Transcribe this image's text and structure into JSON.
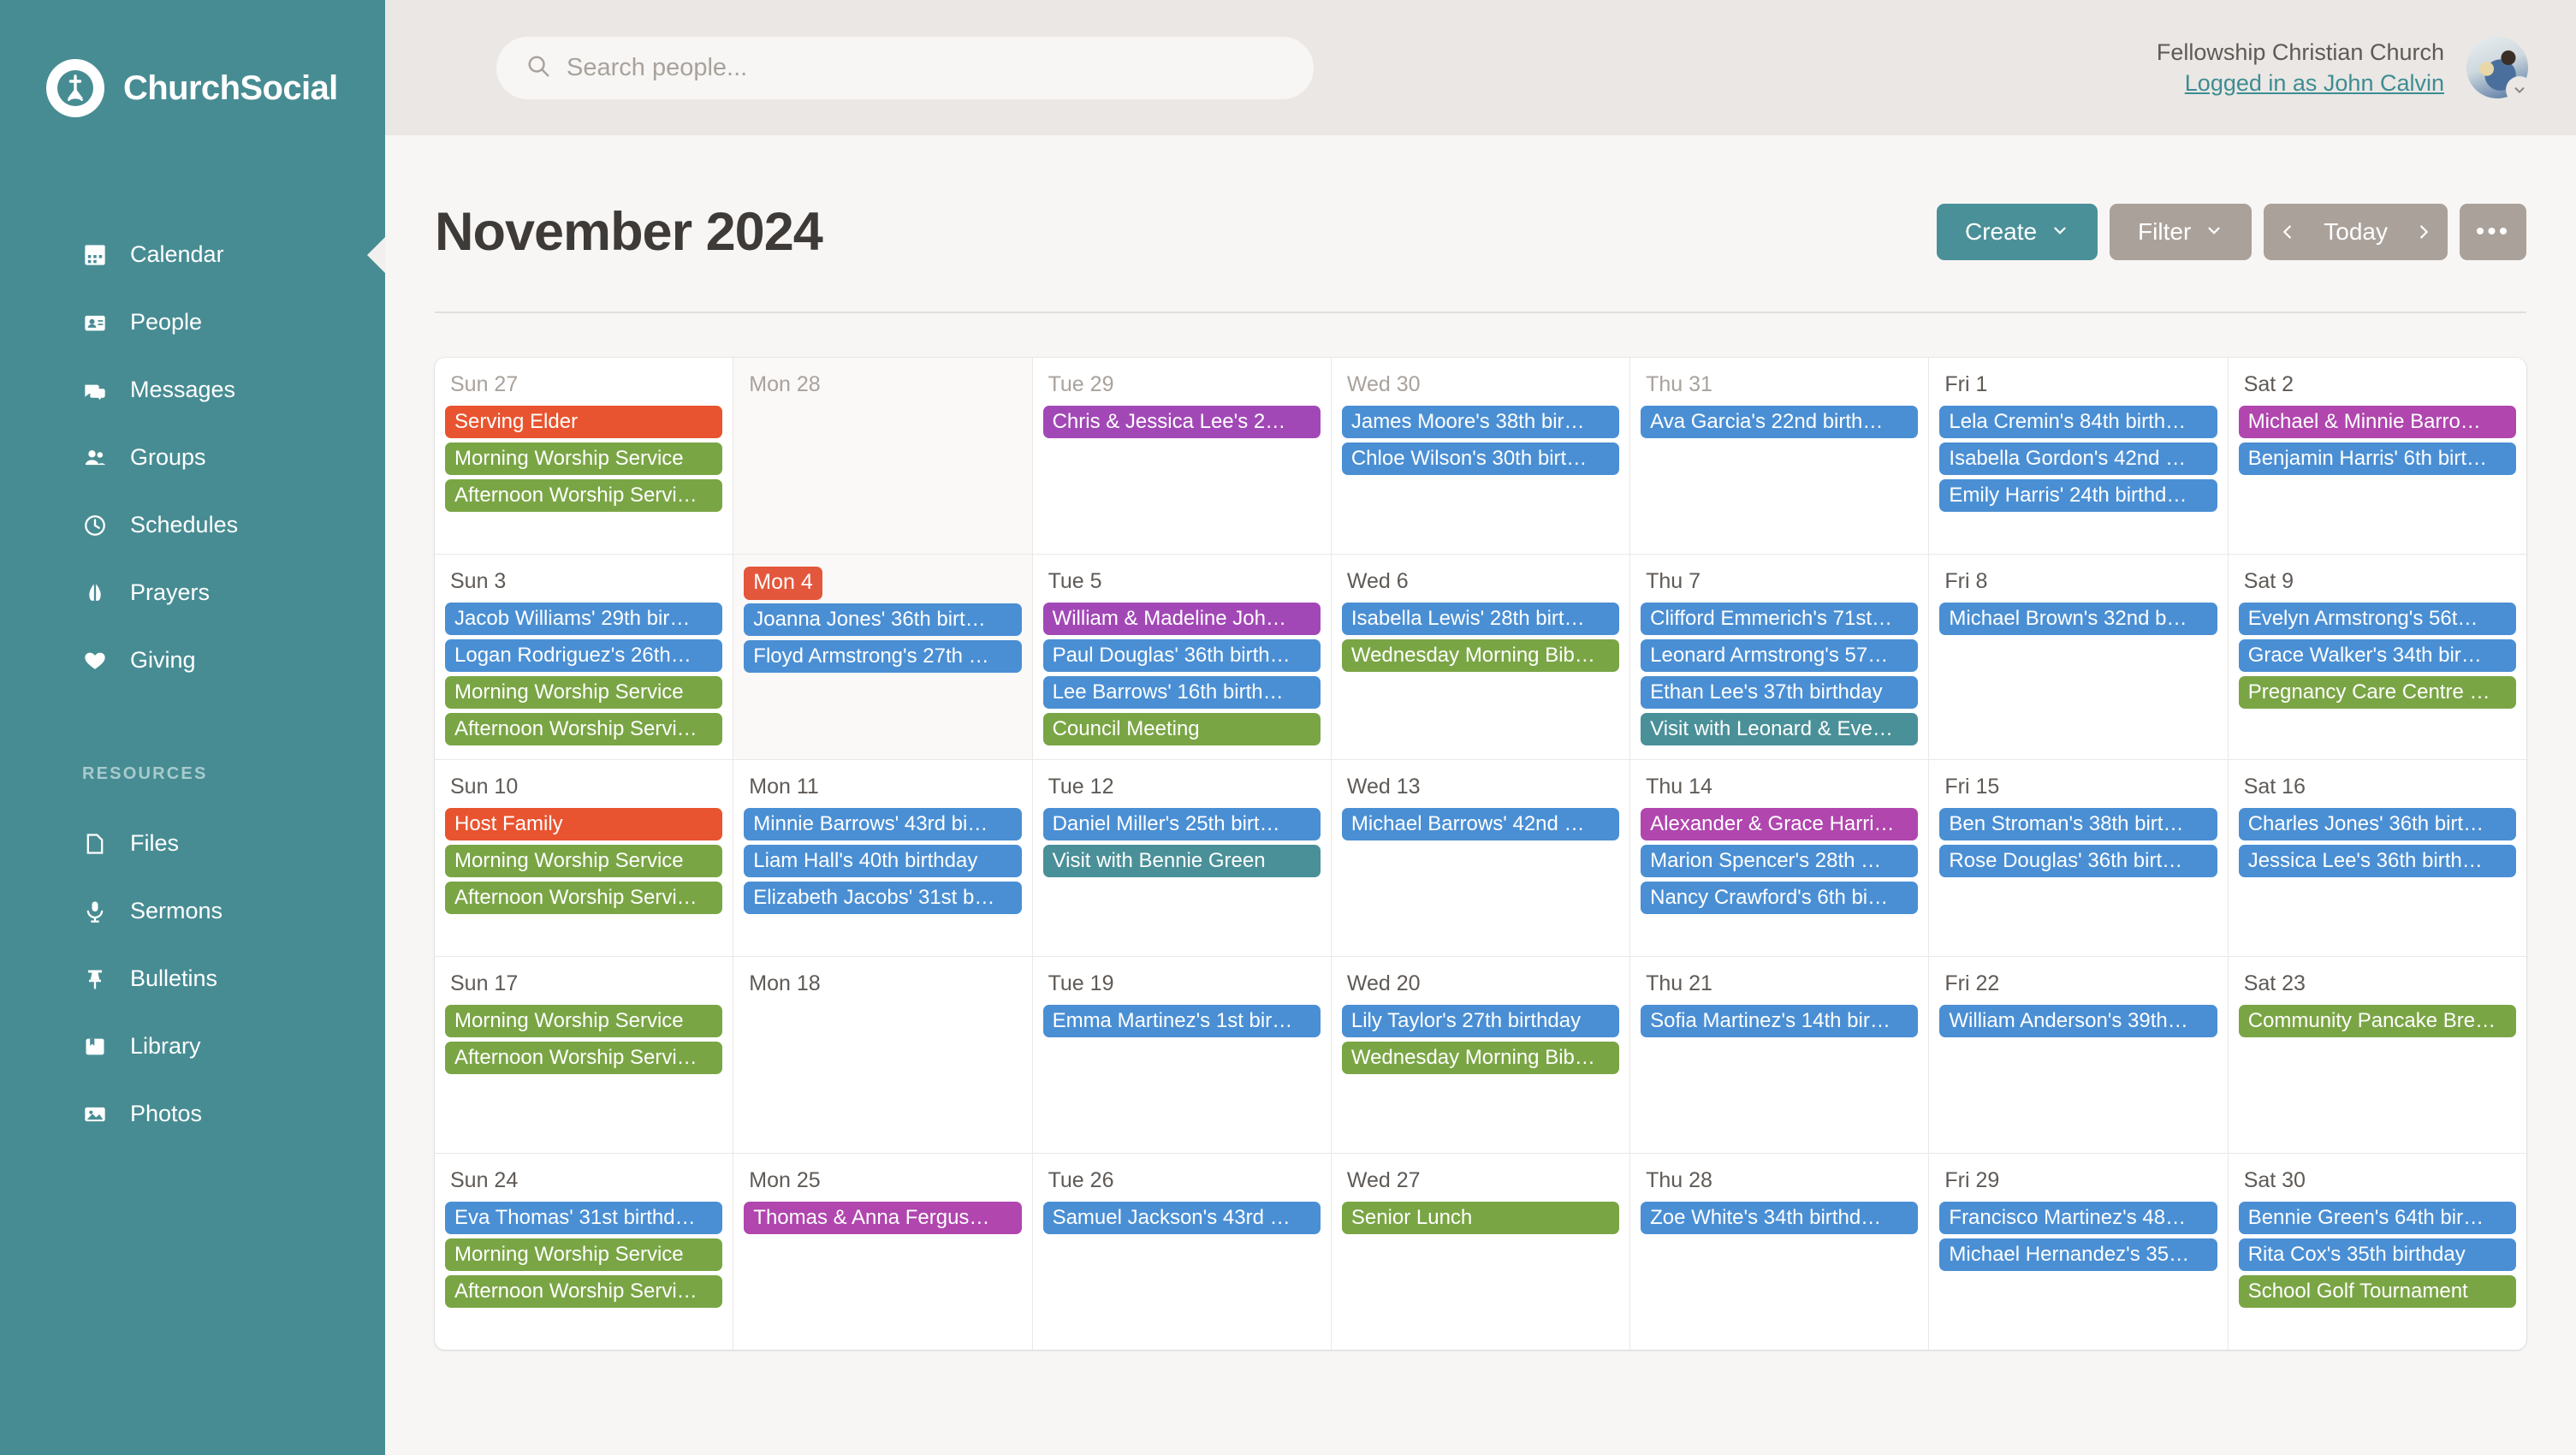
{
  "brand": {
    "name": "ChurchSocial",
    "logo_icon": "church-cross-logo"
  },
  "sidebar": {
    "items": [
      {
        "label": "Calendar",
        "icon": "calendar-icon",
        "active": true
      },
      {
        "label": "People",
        "icon": "people-card-icon",
        "active": false
      },
      {
        "label": "Messages",
        "icon": "messages-icon",
        "active": false
      },
      {
        "label": "Groups",
        "icon": "groups-icon",
        "active": false
      },
      {
        "label": "Schedules",
        "icon": "clock-icon",
        "active": false
      },
      {
        "label": "Prayers",
        "icon": "praying-hands-icon",
        "active": false
      },
      {
        "label": "Giving",
        "icon": "heart-icon",
        "active": false
      }
    ],
    "section_label": "RESOURCES",
    "resources": [
      {
        "label": "Files",
        "icon": "file-icon"
      },
      {
        "label": "Sermons",
        "icon": "microphone-icon"
      },
      {
        "label": "Bulletins",
        "icon": "pushpin-icon"
      },
      {
        "label": "Library",
        "icon": "book-icon"
      },
      {
        "label": "Photos",
        "icon": "photo-icon"
      }
    ]
  },
  "topbar": {
    "search": {
      "placeholder": "Search people...",
      "value": "",
      "icon": "search-icon"
    },
    "org_name": "Fellowship Christian Church",
    "logged_in_as": "Logged in as John Calvin",
    "avatar_icon": "user-avatar",
    "caret_icon": "chevron-down-icon"
  },
  "page": {
    "title": "November 2024"
  },
  "toolbar": {
    "create_label": "Create",
    "create_caret_icon": "chevron-down-icon",
    "filter_label": "Filter",
    "filter_caret_icon": "chevron-down-icon",
    "prev_icon": "chevron-left-icon",
    "today_label": "Today",
    "next_icon": "chevron-right-icon",
    "more_label": "•••"
  },
  "colors": {
    "brand_teal": "#478c93",
    "accent_teal": "#4a9098",
    "today_red": "#e3573c",
    "event_blue": "#4a8fd4",
    "event_green": "#7aa545",
    "event_purple": "#a248b6",
    "event_orange": "#e8542f",
    "event_teal": "#4a9098",
    "button_grey": "#aaa19b"
  },
  "calendar": {
    "weeks": [
      [
        {
          "day_label": "Sun 27",
          "other_month": true,
          "today": false,
          "muted": false,
          "events": [
            {
              "title": "Serving Elder",
              "color": "orange"
            },
            {
              "title": "Morning Worship Service",
              "color": "green"
            },
            {
              "title": "Afternoon Worship Servi…",
              "color": "green"
            }
          ]
        },
        {
          "day_label": "Mon 28",
          "other_month": true,
          "today": false,
          "muted": true,
          "events": []
        },
        {
          "day_label": "Tue 29",
          "other_month": true,
          "today": false,
          "muted": false,
          "events": [
            {
              "title": "Chris & Jessica Lee's 2…",
              "color": "purple"
            }
          ]
        },
        {
          "day_label": "Wed 30",
          "other_month": true,
          "today": false,
          "muted": false,
          "events": [
            {
              "title": "James Moore's 38th bir…",
              "color": "blue"
            },
            {
              "title": "Chloe Wilson's 30th birt…",
              "color": "blue"
            }
          ]
        },
        {
          "day_label": "Thu 31",
          "other_month": true,
          "today": false,
          "muted": false,
          "events": [
            {
              "title": "Ava Garcia's 22nd birth…",
              "color": "blue"
            }
          ]
        },
        {
          "day_label": "Fri 1",
          "other_month": false,
          "today": false,
          "muted": false,
          "events": [
            {
              "title": "Lela Cremin's 84th birth…",
              "color": "blue"
            },
            {
              "title": "Isabella Gordon's 42nd …",
              "color": "blue"
            },
            {
              "title": "Emily Harris' 24th birthd…",
              "color": "blue"
            }
          ]
        },
        {
          "day_label": "Sat 2",
          "other_month": false,
          "today": false,
          "muted": false,
          "events": [
            {
              "title": "Michael & Minnie Barro…",
              "color": "magenta"
            },
            {
              "title": "Benjamin Harris' 6th birt…",
              "color": "blue"
            }
          ]
        }
      ],
      [
        {
          "day_label": "Sun 3",
          "other_month": false,
          "today": false,
          "muted": false,
          "events": [
            {
              "title": "Jacob Williams' 29th bir…",
              "color": "blue"
            },
            {
              "title": "Logan Rodriguez's 26th…",
              "color": "blue"
            },
            {
              "title": "Morning Worship Service",
              "color": "green"
            },
            {
              "title": "Afternoon Worship Servi…",
              "color": "green"
            }
          ]
        },
        {
          "day_label": "Mon 4",
          "other_month": false,
          "today": true,
          "muted": true,
          "events": [
            {
              "title": "Joanna Jones' 36th birt…",
              "color": "blue"
            },
            {
              "title": "Floyd Armstrong's 27th …",
              "color": "blue"
            }
          ]
        },
        {
          "day_label": "Tue 5",
          "other_month": false,
          "today": false,
          "muted": false,
          "events": [
            {
              "title": "William & Madeline Joh…",
              "color": "purple"
            },
            {
              "title": "Paul Douglas' 36th birth…",
              "color": "blue"
            },
            {
              "title": "Lee Barrows' 16th birth…",
              "color": "blue"
            },
            {
              "title": "Council Meeting",
              "color": "green"
            }
          ]
        },
        {
          "day_label": "Wed 6",
          "other_month": false,
          "today": false,
          "muted": false,
          "events": [
            {
              "title": "Isabella Lewis' 28th birt…",
              "color": "blue"
            },
            {
              "title": "Wednesday Morning Bib…",
              "color": "green"
            }
          ]
        },
        {
          "day_label": "Thu 7",
          "other_month": false,
          "today": false,
          "muted": false,
          "events": [
            {
              "title": "Clifford Emmerich's 71st…",
              "color": "blue"
            },
            {
              "title": "Leonard Armstrong's 57…",
              "color": "blue"
            },
            {
              "title": "Ethan Lee's 37th birthday",
              "color": "blue"
            },
            {
              "title": "Visit with Leonard & Eve…",
              "color": "teal"
            }
          ]
        },
        {
          "day_label": "Fri 8",
          "other_month": false,
          "today": false,
          "muted": false,
          "events": [
            {
              "title": "Michael Brown's 32nd b…",
              "color": "blue"
            }
          ]
        },
        {
          "day_label": "Sat 9",
          "other_month": false,
          "today": false,
          "muted": false,
          "events": [
            {
              "title": "Evelyn Armstrong's 56t…",
              "color": "blue"
            },
            {
              "title": "Grace Walker's 34th bir…",
              "color": "blue"
            },
            {
              "title": "Pregnancy Care Centre …",
              "color": "green"
            }
          ]
        }
      ],
      [
        {
          "day_label": "Sun 10",
          "other_month": false,
          "today": false,
          "muted": false,
          "events": [
            {
              "title": "Host Family",
              "color": "orange"
            },
            {
              "title": "Morning Worship Service",
              "color": "green"
            },
            {
              "title": "Afternoon Worship Servi…",
              "color": "green"
            }
          ]
        },
        {
          "day_label": "Mon 11",
          "other_month": false,
          "today": false,
          "muted": false,
          "events": [
            {
              "title": "Minnie Barrows' 43rd bi…",
              "color": "blue"
            },
            {
              "title": "Liam Hall's 40th birthday",
              "color": "blue"
            },
            {
              "title": "Elizabeth Jacobs' 31st b…",
              "color": "blue"
            }
          ]
        },
        {
          "day_label": "Tue 12",
          "other_month": false,
          "today": false,
          "muted": false,
          "events": [
            {
              "title": "Daniel Miller's 25th birt…",
              "color": "blue"
            },
            {
              "title": "Visit with Bennie Green",
              "color": "teal"
            }
          ]
        },
        {
          "day_label": "Wed 13",
          "other_month": false,
          "today": false,
          "muted": false,
          "events": [
            {
              "title": "Michael Barrows' 42nd …",
              "color": "blue"
            }
          ]
        },
        {
          "day_label": "Thu 14",
          "other_month": false,
          "today": false,
          "muted": false,
          "events": [
            {
              "title": "Alexander & Grace Harri…",
              "color": "magenta"
            },
            {
              "title": "Marion Spencer's 28th …",
              "color": "blue"
            },
            {
              "title": "Nancy Crawford's 6th bi…",
              "color": "blue"
            }
          ]
        },
        {
          "day_label": "Fri 15",
          "other_month": false,
          "today": false,
          "muted": false,
          "events": [
            {
              "title": "Ben Stroman's 38th birt…",
              "color": "blue"
            },
            {
              "title": "Rose Douglas' 36th birt…",
              "color": "blue"
            }
          ]
        },
        {
          "day_label": "Sat 16",
          "other_month": false,
          "today": false,
          "muted": false,
          "events": [
            {
              "title": "Charles Jones' 36th birt…",
              "color": "blue"
            },
            {
              "title": "Jessica Lee's 36th birth…",
              "color": "blue"
            }
          ]
        }
      ],
      [
        {
          "day_label": "Sun 17",
          "other_month": false,
          "today": false,
          "muted": false,
          "events": [
            {
              "title": "Morning Worship Service",
              "color": "green"
            },
            {
              "title": "Afternoon Worship Servi…",
              "color": "green"
            }
          ]
        },
        {
          "day_label": "Mon 18",
          "other_month": false,
          "today": false,
          "muted": false,
          "events": []
        },
        {
          "day_label": "Tue 19",
          "other_month": false,
          "today": false,
          "muted": false,
          "events": [
            {
              "title": "Emma Martinez's 1st bir…",
              "color": "blue"
            }
          ]
        },
        {
          "day_label": "Wed 20",
          "other_month": false,
          "today": false,
          "muted": false,
          "events": [
            {
              "title": "Lily Taylor's 27th birthday",
              "color": "blue"
            },
            {
              "title": "Wednesday Morning Bib…",
              "color": "green"
            }
          ]
        },
        {
          "day_label": "Thu 21",
          "other_month": false,
          "today": false,
          "muted": false,
          "events": [
            {
              "title": "Sofia Martinez's 14th bir…",
              "color": "blue"
            }
          ]
        },
        {
          "day_label": "Fri 22",
          "other_month": false,
          "today": false,
          "muted": false,
          "events": [
            {
              "title": "William Anderson's 39th…",
              "color": "blue"
            }
          ]
        },
        {
          "day_label": "Sat 23",
          "other_month": false,
          "today": false,
          "muted": false,
          "events": [
            {
              "title": "Community Pancake Bre…",
              "color": "green"
            }
          ]
        }
      ],
      [
        {
          "day_label": "Sun 24",
          "other_month": false,
          "today": false,
          "muted": false,
          "events": [
            {
              "title": "Eva Thomas' 31st birthd…",
              "color": "blue"
            },
            {
              "title": "Morning Worship Service",
              "color": "green"
            },
            {
              "title": "Afternoon Worship Servi…",
              "color": "green"
            }
          ]
        },
        {
          "day_label": "Mon 25",
          "other_month": false,
          "today": false,
          "muted": false,
          "events": [
            {
              "title": "Thomas & Anna Fergus…",
              "color": "magenta"
            }
          ]
        },
        {
          "day_label": "Tue 26",
          "other_month": false,
          "today": false,
          "muted": false,
          "events": [
            {
              "title": "Samuel Jackson's 43rd …",
              "color": "blue"
            }
          ]
        },
        {
          "day_label": "Wed 27",
          "other_month": false,
          "today": false,
          "muted": false,
          "events": [
            {
              "title": "Senior Lunch",
              "color": "green"
            }
          ]
        },
        {
          "day_label": "Thu 28",
          "other_month": false,
          "today": false,
          "muted": false,
          "events": [
            {
              "title": "Zoe White's 34th birthd…",
              "color": "blue"
            }
          ]
        },
        {
          "day_label": "Fri 29",
          "other_month": false,
          "today": false,
          "muted": false,
          "events": [
            {
              "title": "Francisco Martinez's 48…",
              "color": "blue"
            },
            {
              "title": "Michael Hernandez's 35…",
              "color": "blue"
            }
          ]
        },
        {
          "day_label": "Sat 30",
          "other_month": false,
          "today": false,
          "muted": false,
          "events": [
            {
              "title": "Bennie Green's 64th bir…",
              "color": "blue"
            },
            {
              "title": "Rita Cox's 35th birthday",
              "color": "blue"
            },
            {
              "title": "School Golf Tournament",
              "color": "green"
            }
          ]
        }
      ]
    ]
  }
}
